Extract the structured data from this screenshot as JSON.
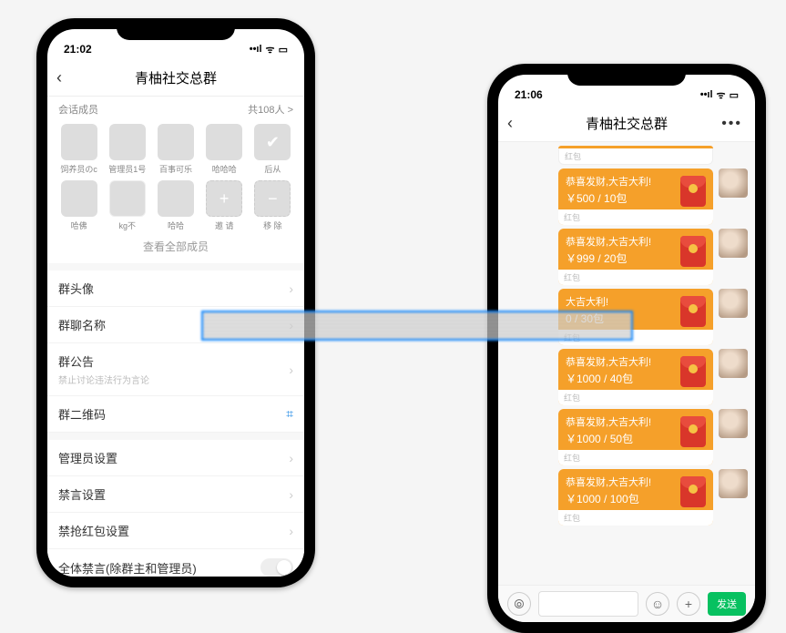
{
  "left": {
    "status_time": "21:02",
    "title": "青柚社交总群",
    "members_header": "会话成员",
    "members_count_text": "共108人 >",
    "members": [
      {
        "name": "饲养员のc",
        "style": "av-green"
      },
      {
        "name": "管理员1号",
        "style": "av-brown"
      },
      {
        "name": "百事可乐",
        "style": "av-dark"
      },
      {
        "name": "哈哈哈",
        "style": "av-pink"
      },
      {
        "name": "后从",
        "style": "av-shield"
      },
      {
        "name": "哈佛",
        "style": "av-tan"
      },
      {
        "name": "kg不",
        "style": "av-wht"
      },
      {
        "name": "哈哈",
        "style": "av-cyan"
      },
      {
        "name": "邀 请",
        "style": "av-plus"
      },
      {
        "name": "移 除",
        "style": "av-minus"
      }
    ],
    "view_all": "查看全部成员",
    "settings": {
      "group_avatar": "群头像",
      "group_name": "群聊名称",
      "announcement": "群公告",
      "announcement_sub": "禁止讨论违法行为言论",
      "qrcode": "群二维码",
      "admin": "管理员设置",
      "mute": "禁言设置",
      "redpack_block": "禁抢红包设置",
      "mute_all": "全体禁言(除群主和管理员)"
    }
  },
  "right": {
    "status_time": "21:06",
    "title": "青柚社交总群",
    "hb_label": "红包",
    "greet": "恭喜发财,大吉大利!",
    "packets": [
      {
        "amount": "￥500 / 10包"
      },
      {
        "amount": "￥999 / 20包"
      },
      {
        "amount": "0 / 30包"
      },
      {
        "amount": "￥1000 / 40包"
      },
      {
        "amount": "￥1000 / 50包"
      },
      {
        "amount": "￥1000 / 100包"
      }
    ],
    "send_label": "发送"
  },
  "icons": {
    "back": "‹",
    "more": "•••",
    "chevron": "›",
    "plus_sym": "+",
    "minus_sym": "−",
    "shield": "✔",
    "qr": "⌗",
    "voice": "⦾",
    "emoji": "☺",
    "plus_circle": "+"
  }
}
